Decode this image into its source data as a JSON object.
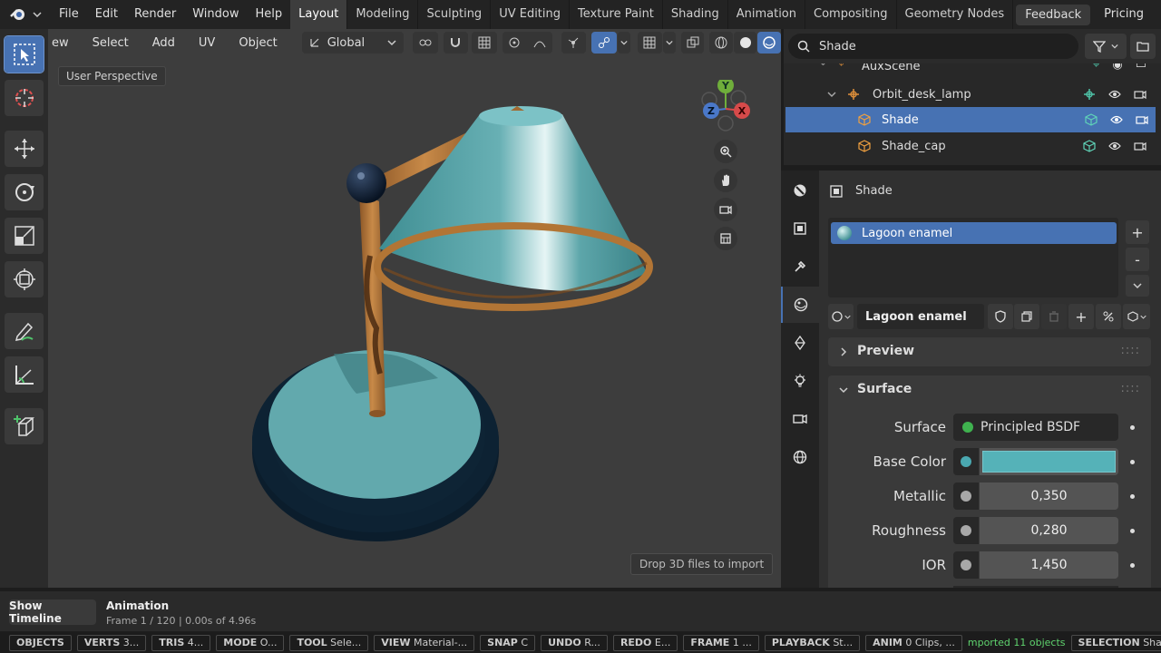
{
  "menu": [
    "File",
    "Edit",
    "Render",
    "Window",
    "Help"
  ],
  "workspaces": [
    "Layout",
    "Modeling",
    "Sculpting",
    "UV Editing",
    "Texture Paint",
    "Shading",
    "Animation",
    "Compositing",
    "Geometry Nodes"
  ],
  "active_workspace": "Layout",
  "top_right": {
    "feedback": "Feedback",
    "pricing": "Pricing"
  },
  "viewport": {
    "menus": [
      "ew",
      "Select",
      "Add",
      "UV",
      "Object"
    ],
    "transform_orientation": "Global",
    "perspective_label": "User Perspective",
    "drop_hint": "Drop 3D files to import",
    "gizmo": {
      "y": "Y",
      "x": "X",
      "z": "Z"
    }
  },
  "outliner": {
    "search_value": "Shade",
    "rows": [
      {
        "label": "AuxScene",
        "indent": 0
      },
      {
        "label": "Orbit_desk_lamp",
        "indent": 1
      },
      {
        "label": "Shade",
        "indent": 2,
        "selected": true
      },
      {
        "label": "Shade_cap",
        "indent": 2
      }
    ]
  },
  "properties": {
    "object_name": "Shade",
    "material_slot": "Lagoon enamel",
    "material_name": "Lagoon enamel",
    "preview_label": "Preview",
    "surface_label": "Surface",
    "fields": [
      {
        "label": "Surface",
        "value": "Principled BSDF",
        "dot": "#3fb24f"
      },
      {
        "label": "Base Color",
        "value": "",
        "dot": "#4aa8b0",
        "swatch": "#55b2b8"
      },
      {
        "label": "Metallic",
        "value": "0,350",
        "dot": "#a8a8a8"
      },
      {
        "label": "Roughness",
        "value": "0,280",
        "dot": "#a8a8a8"
      },
      {
        "label": "IOR",
        "value": "1,450",
        "dot": "#a8a8a8"
      }
    ]
  },
  "timeline": {
    "button": "Show Timeline",
    "title": "Animation",
    "frame_info": "Frame 1 / 120 | 0.00s of 4.96s"
  },
  "statusbar": [
    {
      "key": "OBJECTS",
      "val": ""
    },
    {
      "key": "VERTS",
      "val": "3..."
    },
    {
      "key": "TRIS",
      "val": "4..."
    },
    {
      "key": "MODE",
      "val": "O..."
    },
    {
      "key": "TOOL",
      "val": "Sele..."
    },
    {
      "key": "VIEW",
      "val": "Material-..."
    },
    {
      "key": "SNAP",
      "val": "C"
    },
    {
      "key": "UNDO",
      "val": "R..."
    },
    {
      "key": "REDO",
      "val": "E..."
    },
    {
      "key": "FRAME",
      "val": "1 ..."
    },
    {
      "key": "PLAYBACK",
      "val": "St..."
    },
    {
      "key": "ANIM",
      "val": "0 Clips, ..."
    }
  ],
  "status_message": "mported 11 objects",
  "selection": {
    "key": "SELECTION",
    "val": "Shade"
  },
  "colors": {
    "accent": "#4772b3",
    "lamp_teal": "#5fa8ac",
    "lamp_brass": "#b8763a",
    "status_green": "#5fd36e"
  }
}
